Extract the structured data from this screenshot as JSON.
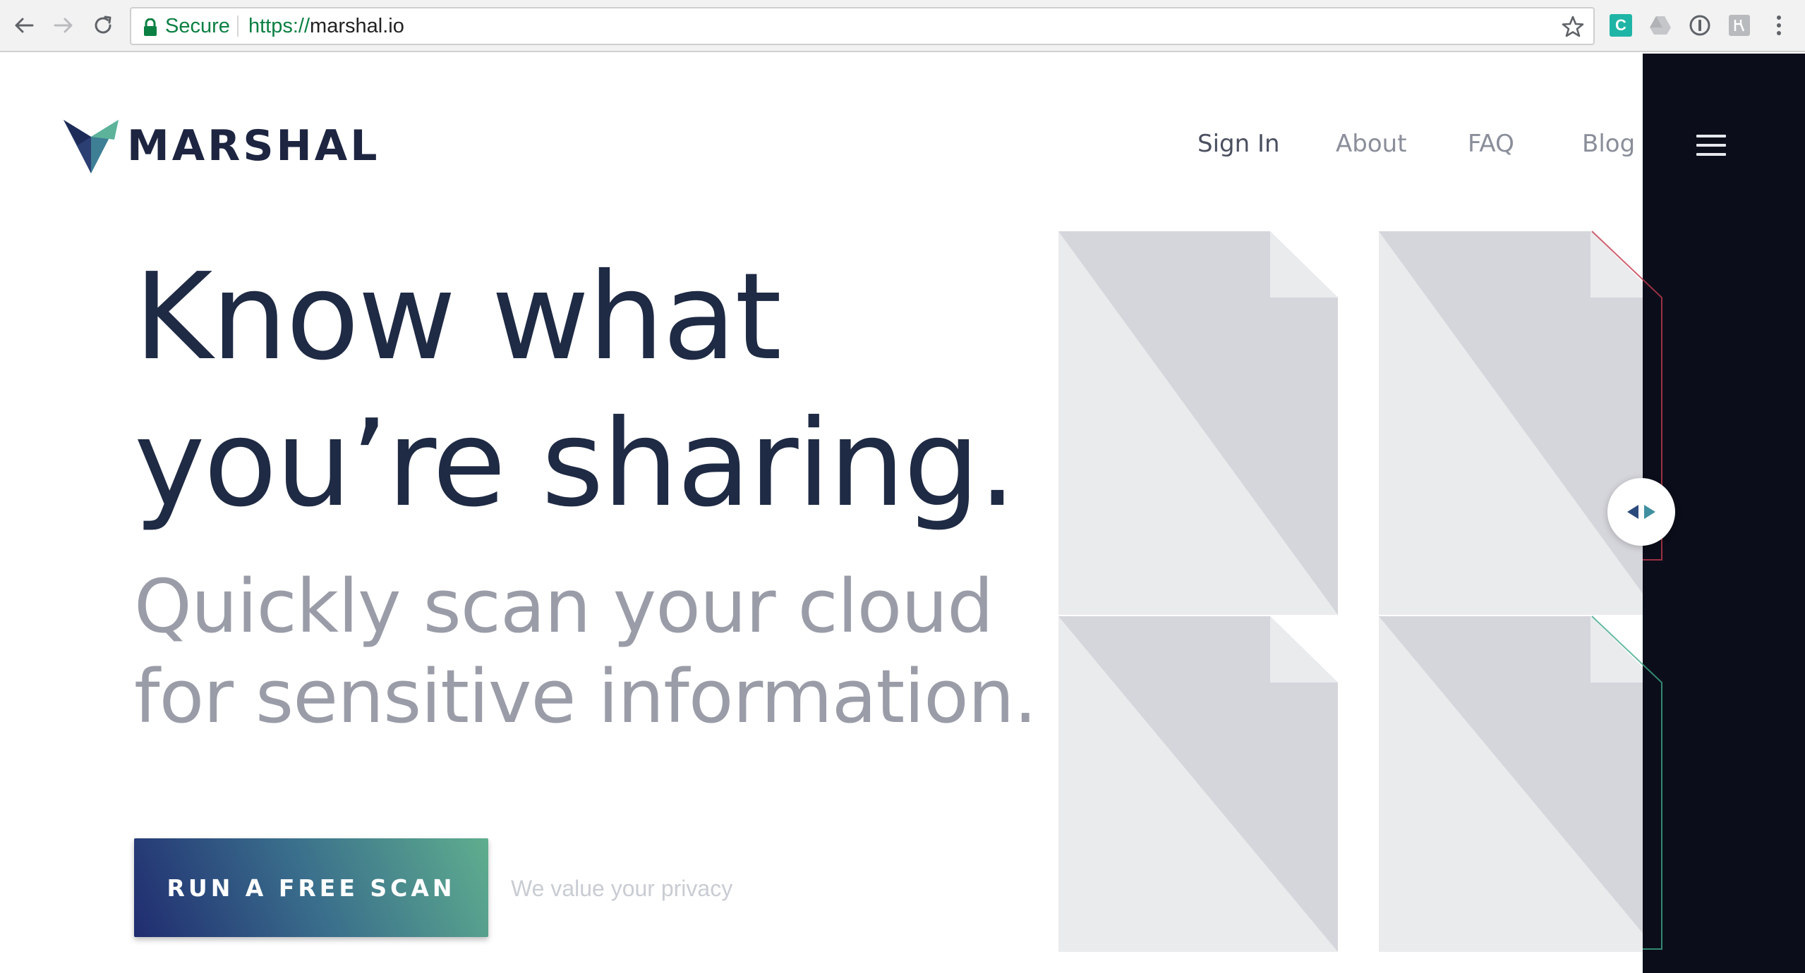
{
  "browser": {
    "security_label": "Secure",
    "url_scheme": "https://",
    "url_host": "marshal.io",
    "extension_c_label": "C"
  },
  "header": {
    "brand": "MARSHAL",
    "nav": [
      {
        "label": "Sign In"
      },
      {
        "label": "About"
      },
      {
        "label": "FAQ"
      },
      {
        "label": "Blog"
      }
    ]
  },
  "hero": {
    "headline_line1": "Know what",
    "headline_line2": "you’re sharing.",
    "subhead_line1": "Quickly scan your cloud",
    "subhead_line2": "for sensitive information.",
    "cta_label": "RUN A FREE SCAN",
    "privacy_link": "We value your privacy"
  },
  "icons": {
    "back": "arrow-left-icon",
    "forward": "arrow-right-icon",
    "reload": "reload-icon",
    "lock": "lock-icon",
    "bookmark": "star-icon",
    "menu": "hamburger-icon",
    "compare": "left-right-arrows-icon"
  },
  "colors": {
    "brand_dark": "#1d2541",
    "headline": "#1f2a44",
    "subhead": "#9a9da8",
    "cta_start": "#202c70",
    "cta_end": "#5fae8e",
    "dark_panel": "#0b0e1a",
    "secure_green": "#0b8043"
  }
}
